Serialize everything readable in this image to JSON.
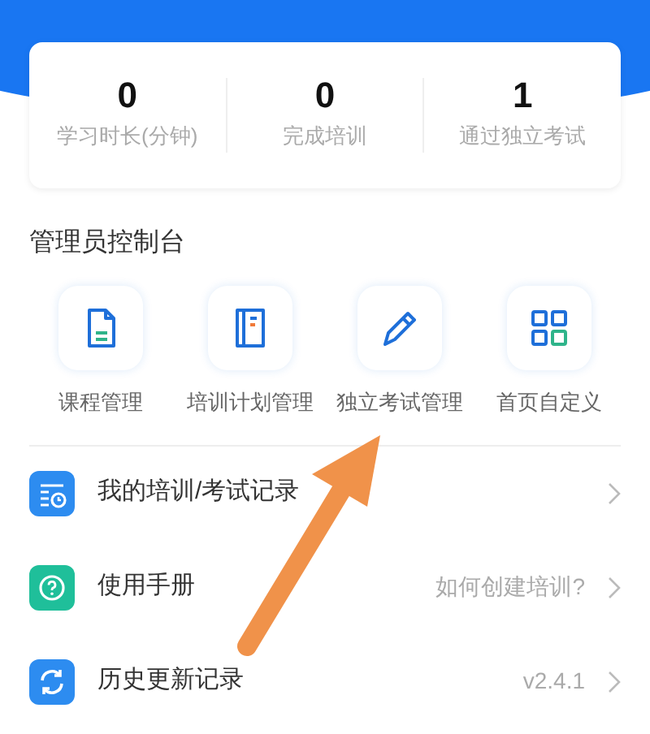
{
  "stats": [
    {
      "value": "0",
      "label": "学习时长(分钟)"
    },
    {
      "value": "0",
      "label": "完成培训"
    },
    {
      "value": "1",
      "label": "通过独立考试"
    }
  ],
  "admin_console": {
    "title": "管理员控制台",
    "items": [
      {
        "kind": "document",
        "label": "课程管理"
      },
      {
        "kind": "book",
        "label": "培训计划管理"
      },
      {
        "kind": "pencil",
        "label": "独立考试管理"
      },
      {
        "kind": "grid",
        "label": "首页自定义"
      }
    ]
  },
  "menu": [
    {
      "kind": "records",
      "label": "我的培训/考试记录"
    },
    {
      "kind": "help",
      "label": "使用手册",
      "detail": "如何创建培训?"
    },
    {
      "kind": "refresh",
      "label": "历史更新记录",
      "detail": "v2.4.1"
    }
  ]
}
